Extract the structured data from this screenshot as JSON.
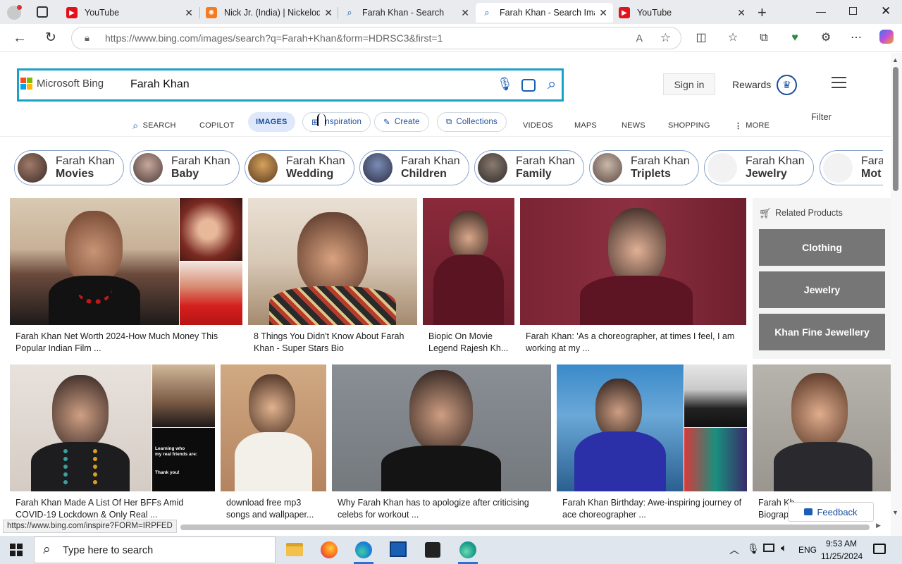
{
  "browser": {
    "tabs": [
      {
        "label": "YouTube",
        "active": false
      },
      {
        "label": "Nick Jr. (India) | Nickelodeon",
        "active": false
      },
      {
        "label": "Farah Khan - Search",
        "active": false
      },
      {
        "label": "Farah Khan - Search Images",
        "active": true
      },
      {
        "label": "YouTube",
        "active": false
      }
    ],
    "url": "https://www.bing.com/images/search?q=Farah+Khan&form=HDRSC3&first=1",
    "status_url": "https://www.bing.com/inspire?FORM=IRPFED"
  },
  "bing": {
    "logo": "Microsoft Bing",
    "query": "Farah Khan",
    "sign_in": "Sign in",
    "rewards": "Rewards",
    "filter": "Filter",
    "nav": [
      "SEARCH",
      "COPILOT",
      "IMAGES",
      "Inspiration",
      "Create",
      "Collections",
      "VIDEOS",
      "MAPS",
      "NEWS",
      "SHOPPING",
      "MORE"
    ],
    "chips": [
      {
        "top": "Farah Khan",
        "bottom": "Movies"
      },
      {
        "top": "Farah Khan",
        "bottom": "Baby"
      },
      {
        "top": "Farah Khan",
        "bottom": "Wedding"
      },
      {
        "top": "Farah Khan",
        "bottom": "Children"
      },
      {
        "top": "Farah Khan",
        "bottom": "Family"
      },
      {
        "top": "Farah Khan",
        "bottom": "Triplets"
      },
      {
        "top": "Farah Khan",
        "bottom": "Jewelry"
      },
      {
        "top": "Fara",
        "bottom": "Mot"
      }
    ],
    "results_row1": [
      {
        "caption": "Farah Khan Net Worth 2024-How Much Money This Popular Indian Film ..."
      },
      {
        "caption": "8 Things You Didn't Know About Farah Khan - Super Stars Bio"
      },
      {
        "caption": "Biopic On Movie Legend Rajesh Kh..."
      },
      {
        "caption": "Farah Khan: 'As a choreographer, at times I feel, I am working at my ..."
      }
    ],
    "results_row2": [
      {
        "caption": "Farah Khan Made A List Of Her BFFs Amid COVID-19 Lockdown & Only Real ..."
      },
      {
        "caption": "download free mp3 songs and wallpaper..."
      },
      {
        "caption": "Why Farah Khan has to apologize after criticising celebs for workout ..."
      },
      {
        "caption": "Farah Khan Birthday: Awe-inspiring journey of ace choreographer ..."
      },
      {
        "caption": "Farah Kh... Biograp..."
      }
    ],
    "related_products": {
      "title": "Related Products",
      "items": [
        "Clothing",
        "Jewelry",
        "Khan Fine Jewellery"
      ]
    },
    "feedback": "Feedback",
    "overlay_text": [
      "Learning who",
      "my real friends are:",
      "Thank you!"
    ]
  },
  "taskbar": {
    "search_placeholder": "Type here to search",
    "lang": "ENG",
    "time": "9:53 AM",
    "date": "11/25/2024"
  },
  "colors": {
    "accent": "#1ba1c6",
    "link": "#1a4e9c",
    "youtube": "#e0121b"
  }
}
